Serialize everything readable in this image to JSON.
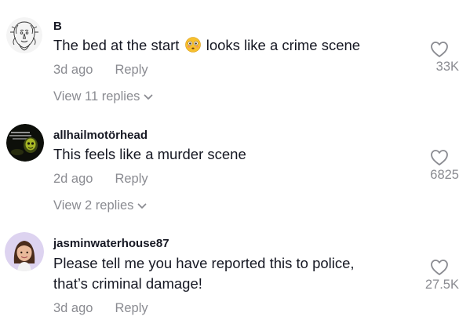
{
  "comments": [
    {
      "username": "B",
      "text_before": "The bed at the start",
      "emoji": "flushed-face-emoji",
      "text_after": "looks like a crime scene",
      "time": "3d ago",
      "reply_label": "Reply",
      "like_count": "33K",
      "view_replies": "View 11 replies"
    },
    {
      "username": "allhailmotörhead",
      "text": "This feels like a murder scene",
      "time": "2d ago",
      "reply_label": "Reply",
      "like_count": "6825",
      "view_replies": "View 2 replies"
    },
    {
      "username": "jasminwaterhouse87",
      "text_line1": "Please tell me you have reported this to police,",
      "text_line2": "that’s criminal damage!",
      "time": "3d ago",
      "reply_label": "Reply",
      "like_count": "27.5K"
    }
  ],
  "colors": {
    "primary_text": "#161823",
    "secondary_text": "#8a8b91",
    "heart_outline": "#8a8b91"
  },
  "icons": {
    "like": "heart-outline-icon",
    "expand": "chevron-down-icon"
  }
}
